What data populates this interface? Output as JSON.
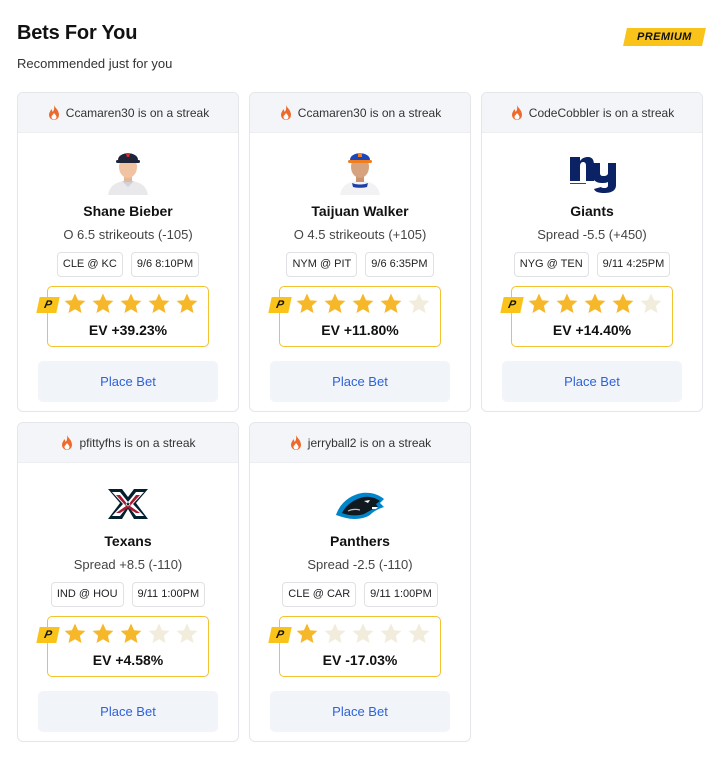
{
  "header": {
    "title": "Bets For You",
    "subtitle": "Recommended just for you",
    "premium_badge": "PREMIUM"
  },
  "colors": {
    "accent_yellow": "#f9c31a",
    "star_filled": "#f6b82a",
    "star_empty": "#f2ecdd",
    "link_blue": "#2e62d9",
    "streak_flame": "#ec6a2c"
  },
  "cards": [
    {
      "streak": "Ccamaren30 is on a streak",
      "logo": "player-headshot-shane-bieber",
      "name": "Shane Bieber",
      "line": "O 6.5 strikeouts (-105)",
      "matchup": "CLE @ KC",
      "time": "9/6 8:10PM",
      "badge": "P",
      "stars": 5,
      "ev": "EV +39.23%",
      "button": "Place Bet"
    },
    {
      "streak": "Ccamaren30 is on a streak",
      "logo": "player-headshot-taijuan-walker",
      "name": "Taijuan Walker",
      "line": "O 4.5 strikeouts (+105)",
      "matchup": "NYM @ PIT",
      "time": "9/6 6:35PM",
      "badge": "P",
      "stars": 4,
      "ev": "EV +11.80%",
      "button": "Place Bet"
    },
    {
      "streak": "CodeCobbler is on a streak",
      "logo": "giants-logo",
      "name": "Giants",
      "line": "Spread -5.5 (+450)",
      "matchup": "NYG @ TEN",
      "time": "9/11 4:25PM",
      "badge": "P",
      "stars": 4,
      "ev": "EV +14.40%",
      "button": "Place Bet"
    },
    {
      "streak": "pfittyfhs is on a streak",
      "logo": "texans-logo",
      "name": "Texans",
      "line": "Spread +8.5 (-110)",
      "matchup": "IND @ HOU",
      "time": "9/11 1:00PM",
      "badge": "P",
      "stars": 3,
      "ev": "EV +4.58%",
      "button": "Place Bet"
    },
    {
      "streak": "jerryball2 is on a streak",
      "logo": "panthers-logo",
      "name": "Panthers",
      "line": "Spread -2.5 (-110)",
      "matchup": "CLE @ CAR",
      "time": "9/11 1:00PM",
      "badge": "P",
      "stars": 1,
      "ev": "EV -17.03%",
      "button": "Place Bet"
    }
  ]
}
